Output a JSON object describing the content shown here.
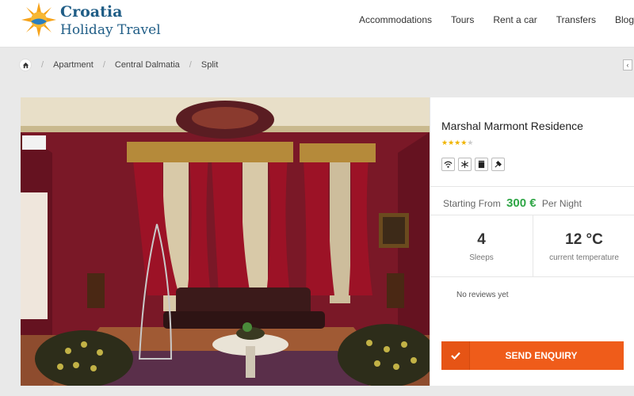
{
  "brand": {
    "line1": "Croatia",
    "line2": "Holiday Travel"
  },
  "nav": [
    "Accommodations",
    "Tours",
    "Rent a car",
    "Transfers",
    "Blog"
  ],
  "breadcrumb": [
    "Apartment",
    "Central Dalmatia",
    "Split"
  ],
  "property": {
    "title": "Marshal Marmont Residence",
    "stars": 4,
    "stars_max": 5,
    "amenities": [
      "wifi-icon",
      "air-conditioning-icon",
      "tv-icon",
      "kitchen-icon"
    ],
    "price_prefix": "Starting From",
    "price": "300 €",
    "price_suffix": "Per Night",
    "sleeps_value": "4",
    "sleeps_label": "Sleeps",
    "temp_value": "12 °C",
    "temp_label": "current temperature",
    "reviews_text": "No reviews yet",
    "enquiry_label": "SEND ENQUIRY"
  },
  "colors": {
    "accent": "#ef5c1a",
    "price": "#2fa646",
    "brand": "#1f5d86"
  }
}
